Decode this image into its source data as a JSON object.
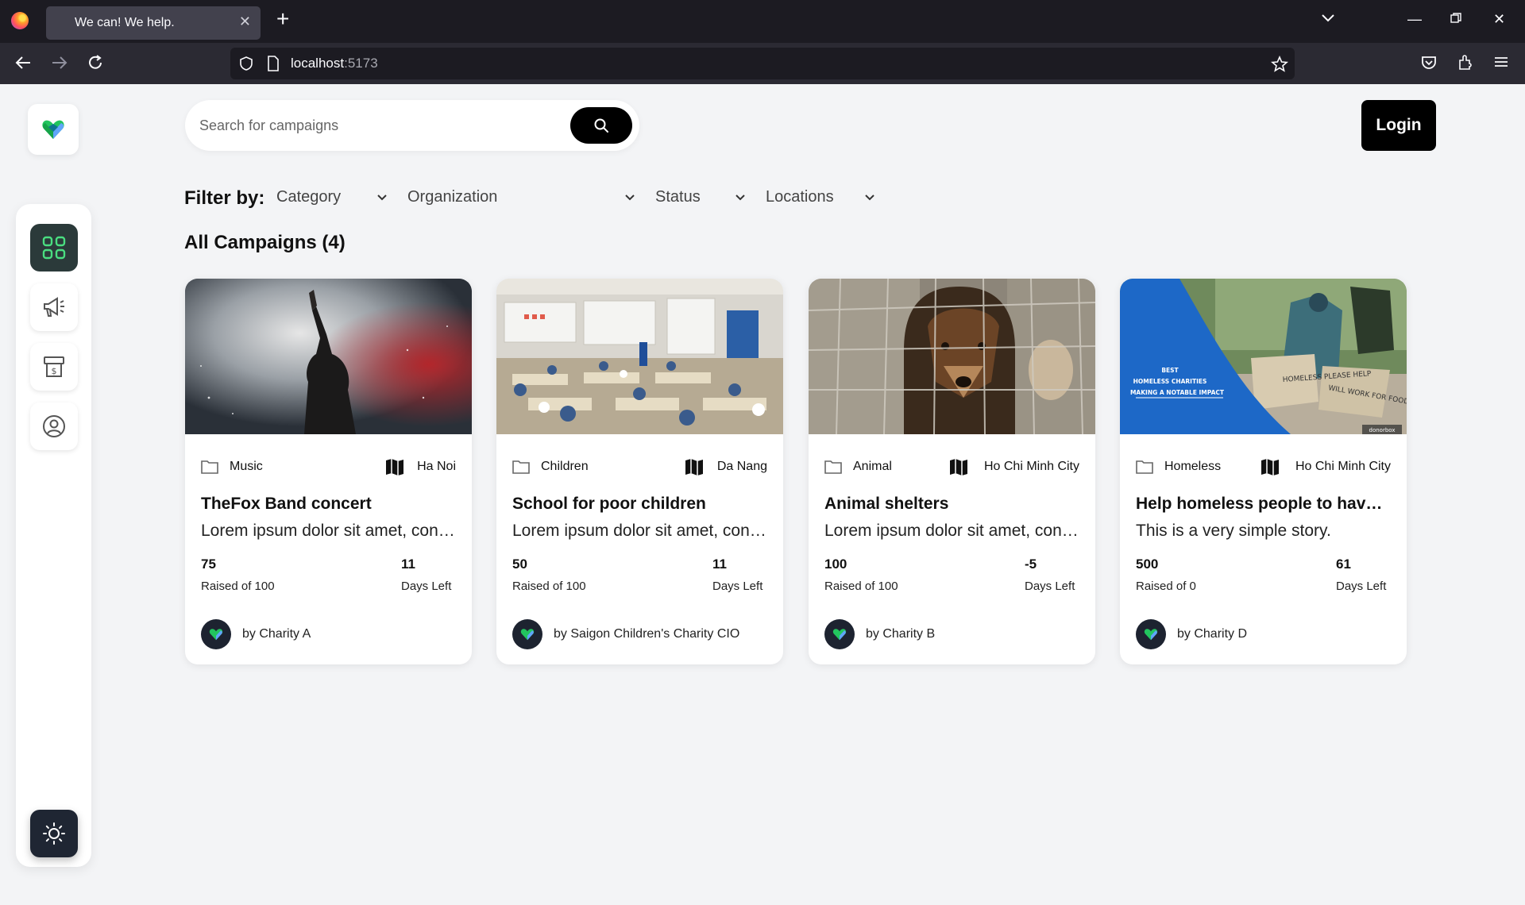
{
  "browser": {
    "tab_title": "We can! We help.",
    "url_host": "localhost",
    "url_port": ":5173"
  },
  "search": {
    "placeholder": "Search for campaigns"
  },
  "header": {
    "login_label": "Login"
  },
  "filters": {
    "label": "Filter by:",
    "category": "Category",
    "organization": "Organization",
    "status": "Status",
    "locations": "Locations"
  },
  "campaigns_heading": "All Campaigns (4)",
  "cards": [
    {
      "category": "Music",
      "location": "Ha Noi",
      "title": "TheFox Band concert",
      "description": "Lorem ipsum dolor sit amet, consectetur adipiscing elit",
      "raised": "75",
      "raised_label": "Raised of 100",
      "days": "11",
      "days_label": "Days Left",
      "owner": "by Charity A",
      "image": "concert-photo"
    },
    {
      "category": "Children",
      "location": "Da Nang",
      "title": "School for poor children",
      "description": "Lorem ipsum dolor sit amet, consectetur adipiscing elit",
      "raised": "50",
      "raised_label": "Raised of 100",
      "days": "11",
      "days_label": "Days Left",
      "owner": "by Saigon Children's Charity CIO",
      "image": "classroom-photo"
    },
    {
      "category": "Animal",
      "location": "Ho Chi Minh City",
      "title": "Animal shelters",
      "description": "Lorem ipsum dolor sit amet, consectetur adipiscing elit",
      "raised": "100",
      "raised_label": "Raised of 100",
      "days": "-5",
      "days_label": "Days Left",
      "owner": "by Charity B",
      "image": "dog-photo"
    },
    {
      "category": "Homeless",
      "location": "Ho Chi Minh City",
      "title": "Help homeless people to have a home",
      "description": "This is a very simple story.",
      "raised": "500",
      "raised_label": "Raised of 0",
      "days": "61",
      "days_label": "Days Left",
      "owner": "by Charity D",
      "image": "homeless-banner",
      "banner_text": [
        "BEST",
        "HOMELESS CHARITIES",
        "MAKING A NOTABLE IMPACT"
      ],
      "sign_text": "HOMELESS PLEASE HELP",
      "sign_text_2": "WILL WORK FOR FOOD",
      "watermark": "donorbox"
    }
  ],
  "colors": {
    "accent": "#22c55e",
    "dark": "#000000",
    "sidebar_active": "#2b3a3a"
  }
}
